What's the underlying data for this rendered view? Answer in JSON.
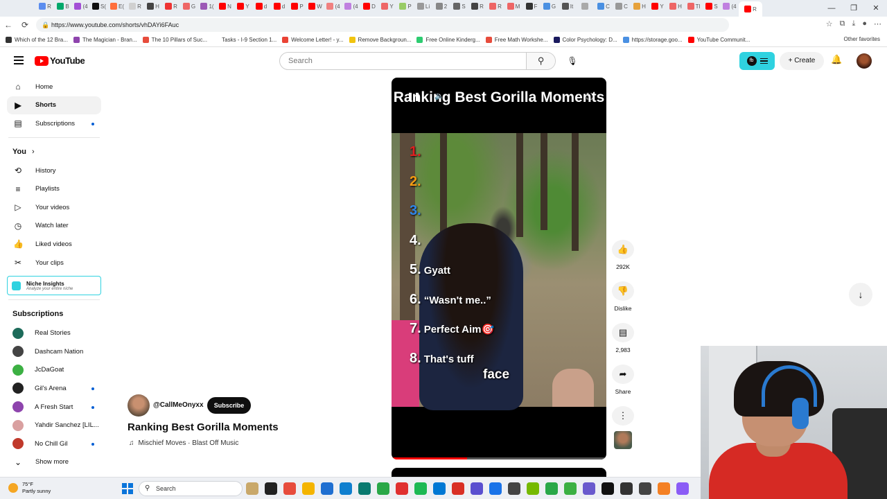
{
  "browser": {
    "url": "https://www.youtube.com/shorts/vhDAYi6FAuc",
    "tabs": [
      {
        "label": "R",
        "color": "#5b8def"
      },
      {
        "label": "B",
        "color": "#00a86b"
      },
      {
        "label": "(4",
        "color": "#a34fd6"
      },
      {
        "label": "S(",
        "color": "#111111"
      },
      {
        "label": "E(",
        "color": "#ff6f3c"
      },
      {
        "label": "R",
        "color": "#d0d0d0"
      },
      {
        "label": "H",
        "color": "#444444"
      },
      {
        "label": "R",
        "color": "#ee3333"
      },
      {
        "label": "G",
        "color": "#ee6666"
      },
      {
        "label": "1(",
        "color": "#9b59b6"
      },
      {
        "label": "N",
        "color": "#ff0000"
      },
      {
        "label": "Y",
        "color": "#ff0000"
      },
      {
        "label": "d",
        "color": "#ff0000"
      },
      {
        "label": "d",
        "color": "#ff0000"
      },
      {
        "label": "P",
        "color": "#ff0000"
      },
      {
        "label": "W",
        "color": "#ff0000"
      },
      {
        "label": "(4",
        "color": "#f08080"
      },
      {
        "label": "(4",
        "color": "#c080e0"
      },
      {
        "label": "D",
        "color": "#ff0000"
      },
      {
        "label": "Y",
        "color": "#ee6666"
      },
      {
        "label": "P",
        "color": "#99cc66"
      },
      {
        "label": "Li",
        "color": "#999999"
      },
      {
        "label": "2",
        "color": "#888888"
      },
      {
        "label": "S",
        "color": "#666666"
      },
      {
        "label": "R",
        "color": "#444444"
      },
      {
        "label": "R",
        "color": "#ee6666"
      },
      {
        "label": "M",
        "color": "#ee6666"
      },
      {
        "label": "F",
        "color": "#333333"
      },
      {
        "label": "G",
        "color": "#4a90e2"
      },
      {
        "label": "It",
        "color": "#555555"
      },
      {
        "label": "",
        "color": "#aaaaaa"
      },
      {
        "label": "C",
        "color": "#4a90e2"
      },
      {
        "label": "C",
        "color": "#999999"
      },
      {
        "label": "H",
        "color": "#e6a23c"
      },
      {
        "label": "Y",
        "color": "#ff0000"
      },
      {
        "label": "H",
        "color": "#ee6666"
      },
      {
        "label": "Tl",
        "color": "#ee6666"
      },
      {
        "label": "S",
        "color": "#ff0000"
      },
      {
        "label": "(4",
        "color": "#c080e0"
      },
      {
        "label": "R",
        "color": "#ff0000"
      }
    ],
    "bookmarks": [
      {
        "label": "Which of the 12 Bra...",
        "color": "#333333"
      },
      {
        "label": "The Magician - Bran...",
        "color": "#8e44ad"
      },
      {
        "label": "The 10 Pillars of Suc...",
        "color": "#e74c3c"
      },
      {
        "label": "Tasks - I-9 Section 1...",
        "color": "#ffffff"
      },
      {
        "label": "Welcome Letter! - y...",
        "color": "#ea4335"
      },
      {
        "label": "Remove Backgroun...",
        "color": "#f1c40f"
      },
      {
        "label": "Free Online Kinderg...",
        "color": "#2ecc71"
      },
      {
        "label": "Free Math Workshe...",
        "color": "#e74c3c"
      },
      {
        "label": "Color Psychology: D...",
        "color": "#1a1a5e"
      },
      {
        "label": "https://storage.goo...",
        "color": "#4a90e2"
      },
      {
        "label": "YouTube Communit...",
        "color": "#ff0000"
      }
    ],
    "other_favorites": "Other favorites"
  },
  "header": {
    "logo_text": "YouTube",
    "search_placeholder": "Search",
    "create_label": "Create"
  },
  "sidebar": {
    "main": [
      {
        "label": "Home",
        "icon": "⌂",
        "name": "home"
      },
      {
        "label": "Shorts",
        "icon": "▶",
        "name": "shorts"
      },
      {
        "label": "Subscriptions",
        "icon": "▤",
        "name": "subscriptions"
      }
    ],
    "you_heading": "You",
    "you": [
      {
        "label": "History",
        "icon": "⟲",
        "name": "history"
      },
      {
        "label": "Playlists",
        "icon": "≡",
        "name": "playlists"
      },
      {
        "label": "Your videos",
        "icon": "▷",
        "name": "your-videos"
      },
      {
        "label": "Watch later",
        "icon": "◷",
        "name": "watch-later"
      },
      {
        "label": "Liked videos",
        "icon": "👍",
        "name": "liked-videos"
      },
      {
        "label": "Your clips",
        "icon": "✂",
        "name": "your-clips"
      }
    ],
    "niche": {
      "title": "Niche Insights",
      "subtitle": "Analyze your entire niche"
    },
    "subs_heading": "Subscriptions",
    "subs": [
      {
        "label": "Real Stories",
        "color": "#1d6b5a",
        "dot": false
      },
      {
        "label": "Dashcam Nation",
        "color": "#444444",
        "dot": false
      },
      {
        "label": "JcDaGoat",
        "color": "#3cb043",
        "dot": false
      },
      {
        "label": "Gil's Arena",
        "color": "#222222",
        "dot": true
      },
      {
        "label": "A Fresh Start",
        "color": "#8e44ad",
        "dot": true
      },
      {
        "label": "Yahdir Sanchez [LIL...",
        "color": "#d9a0a0",
        "dot": false
      },
      {
        "label": "No Chill Gil",
        "color": "#c0392b",
        "dot": true
      }
    ],
    "show_more": "Show more"
  },
  "short": {
    "title": "Ranking Best Gorilla Moments",
    "channel": "@CallMeOnyxx",
    "subscribe": "Subscribe",
    "music": "Mischief Moves · Blast Off Music",
    "overlay_title": "Ranking Best Gorilla Moments",
    "caption": "face",
    "progress": 0.35,
    "ranks": [
      {
        "num": "1.",
        "color": "#e02020",
        "label": ""
      },
      {
        "num": "2.",
        "color": "#f39c12",
        "label": ""
      },
      {
        "num": "3.",
        "color": "#2f86e8",
        "label": ""
      },
      {
        "num": "4.",
        "color": "#ffffff",
        "label": ""
      },
      {
        "num": "5.",
        "color": "#ffffff",
        "label": "Gyatt"
      },
      {
        "num": "6.",
        "color": "#ffffff",
        "label": "“Wasn't me..”"
      },
      {
        "num": "7.",
        "color": "#ffffff",
        "label": "Perfect Aim🎯"
      },
      {
        "num": "8.",
        "color": "#ffffff",
        "label": "That's tuff"
      }
    ]
  },
  "actions": {
    "likes": "292K",
    "dislike": "Dislike",
    "comments": "2,983",
    "share": "Share"
  },
  "taskbar": {
    "temp": "75°F",
    "condition": "Partly sunny",
    "search": "Search",
    "apps": [
      "#c9a86a",
      "#222222",
      "#e74c3c",
      "#f4b400",
      "#1f6fd1",
      "#0f7fcf",
      "#0a7a70",
      "#2aa848",
      "#e03030",
      "#1db954",
      "#0078d4",
      "#d93025",
      "#5a4fcf",
      "#1a73e8",
      "#444444",
      "#76b900",
      "#2aa848",
      "#3cb043",
      "#6a5acd",
      "#111111",
      "#333333",
      "#444444",
      "#f48024",
      "#8b5cf6"
    ]
  }
}
